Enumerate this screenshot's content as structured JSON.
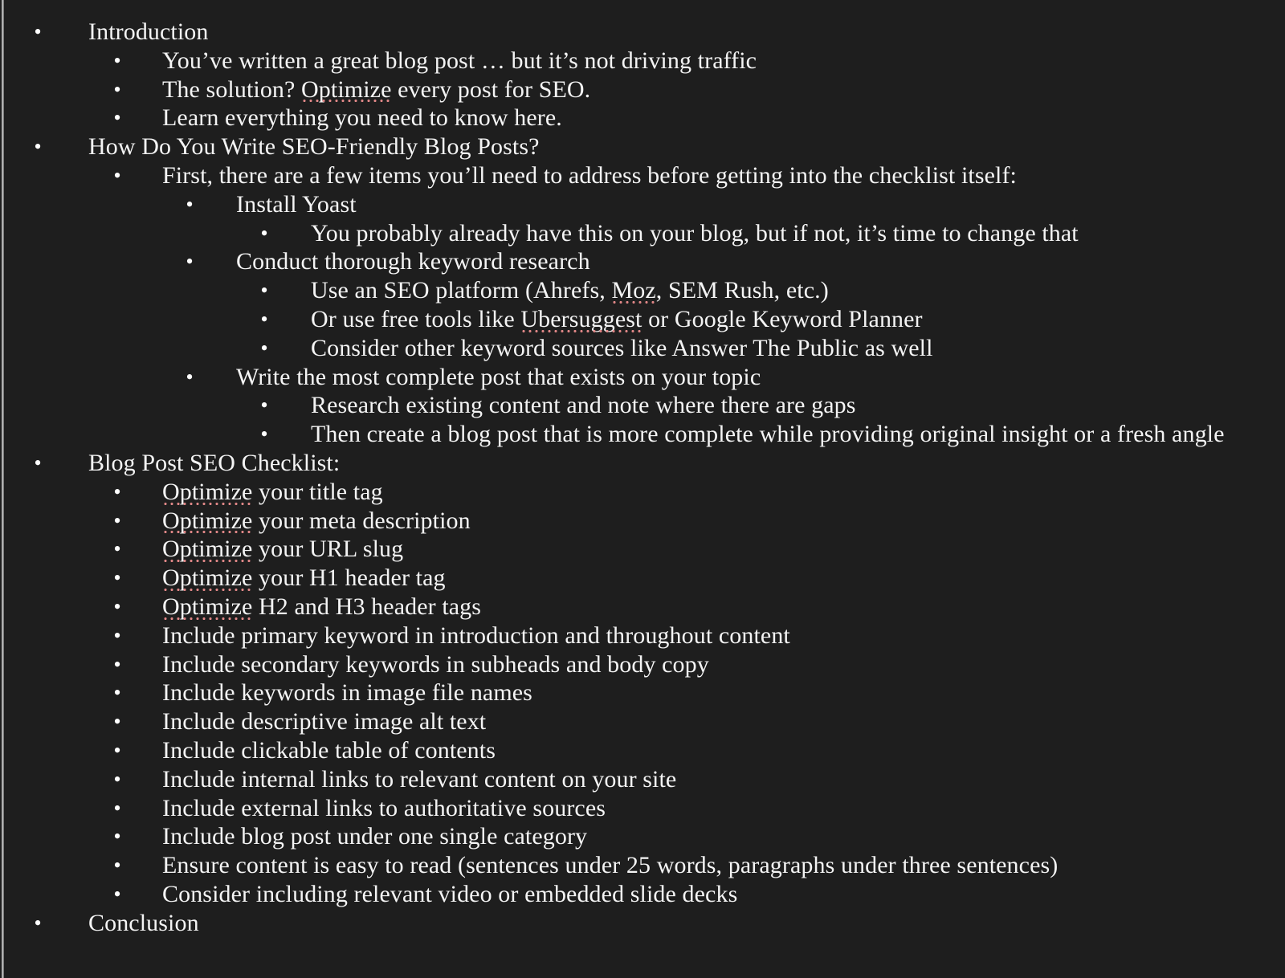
{
  "document": {
    "type": "outline",
    "background_color": "#1e1e1e",
    "text_color": "#f4f4f4",
    "spellcheck_underline_color": "#dd8585",
    "gutter_rule_color": "#c9c9c9"
  },
  "outline": [
    {
      "level": 1,
      "text": "Introduction",
      "misspelled": []
    },
    {
      "level": 2,
      "text": "You’ve written a great blog post … but it’s not driving traffic",
      "misspelled": []
    },
    {
      "level": 2,
      "text": "The solution? Optimize every post for SEO.",
      "misspelled": [
        "Optimize"
      ]
    },
    {
      "level": 2,
      "text": "Learn everything you need to know here.",
      "misspelled": []
    },
    {
      "level": 1,
      "text": "How Do You Write SEO-Friendly Blog Posts?",
      "misspelled": []
    },
    {
      "level": 2,
      "text": "First, there are a few items you’ll need to address before getting into the checklist itself:",
      "misspelled": []
    },
    {
      "level": 3,
      "text": "Install Yoast",
      "misspelled": []
    },
    {
      "level": 4,
      "text": "You probably already have this on your blog, but if not, it’s time to change that",
      "misspelled": []
    },
    {
      "level": 3,
      "text": "Conduct thorough keyword research",
      "misspelled": []
    },
    {
      "level": 4,
      "text": "Use an SEO platform (Ahrefs, Moz, SEM Rush, etc.)",
      "misspelled": [
        "Moz"
      ]
    },
    {
      "level": 4,
      "text": "Or use free tools like Ubersuggest or Google Keyword Planner",
      "misspelled": [
        "Ubersuggest"
      ]
    },
    {
      "level": 4,
      "text": "Consider other keyword sources like Answer The Public as well",
      "misspelled": []
    },
    {
      "level": 3,
      "text": "Write the most complete post that exists on your topic",
      "misspelled": []
    },
    {
      "level": 4,
      "text": "Research existing content and note where there are gaps",
      "misspelled": []
    },
    {
      "level": 4,
      "text": "Then create a blog post that is more complete while providing original insight or a fresh angle",
      "misspelled": []
    },
    {
      "level": 1,
      "text": "Blog Post SEO Checklist:",
      "misspelled": []
    },
    {
      "level": 2,
      "text": "Optimize your title tag",
      "misspelled": [
        "Optimize"
      ]
    },
    {
      "level": 2,
      "text": "Optimize your meta description",
      "misspelled": [
        "Optimize"
      ]
    },
    {
      "level": 2,
      "text": "Optimize your URL slug",
      "misspelled": [
        "Optimize"
      ]
    },
    {
      "level": 2,
      "text": "Optimize your H1 header tag",
      "misspelled": [
        "Optimize"
      ]
    },
    {
      "level": 2,
      "text": "Optimize H2 and H3 header tags",
      "misspelled": [
        "Optimize"
      ]
    },
    {
      "level": 2,
      "text": "Include primary keyword in introduction and throughout content",
      "misspelled": []
    },
    {
      "level": 2,
      "text": "Include secondary keywords in subheads and body copy",
      "misspelled": []
    },
    {
      "level": 2,
      "text": "Include keywords in image file names",
      "misspelled": []
    },
    {
      "level": 2,
      "text": "Include descriptive image alt text",
      "misspelled": []
    },
    {
      "level": 2,
      "text": "Include clickable table of contents",
      "misspelled": []
    },
    {
      "level": 2,
      "text": "Include internal links to relevant content on your site",
      "misspelled": []
    },
    {
      "level": 2,
      "text": "Include external links to authoritative sources",
      "misspelled": []
    },
    {
      "level": 2,
      "text": "Include blog post under one single category",
      "misspelled": []
    },
    {
      "level": 2,
      "text": "Ensure content is easy to read (sentences under 25 words, paragraphs under three sentences)",
      "misspelled": []
    },
    {
      "level": 2,
      "text": "Consider including relevant video or embedded slide decks",
      "misspelled": []
    },
    {
      "level": 1,
      "text": "Conclusion",
      "misspelled": []
    }
  ],
  "bullet_glyph": "•"
}
